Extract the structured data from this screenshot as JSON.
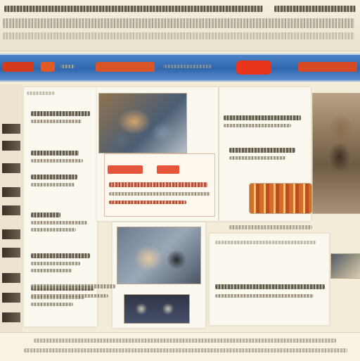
{
  "colors": {
    "page_bg": "#f3ecd9",
    "nav_blue": "#2f66ad",
    "accent_red": "#d43b1c"
  },
  "masthead": {
    "title": ""
  },
  "nav": {
    "items": [
      {
        "label": ""
      },
      {
        "label": ""
      },
      {
        "label": ""
      },
      {
        "label": ""
      },
      {
        "label": ""
      }
    ]
  },
  "icons": {
    "logo": "site-logo-icon"
  }
}
